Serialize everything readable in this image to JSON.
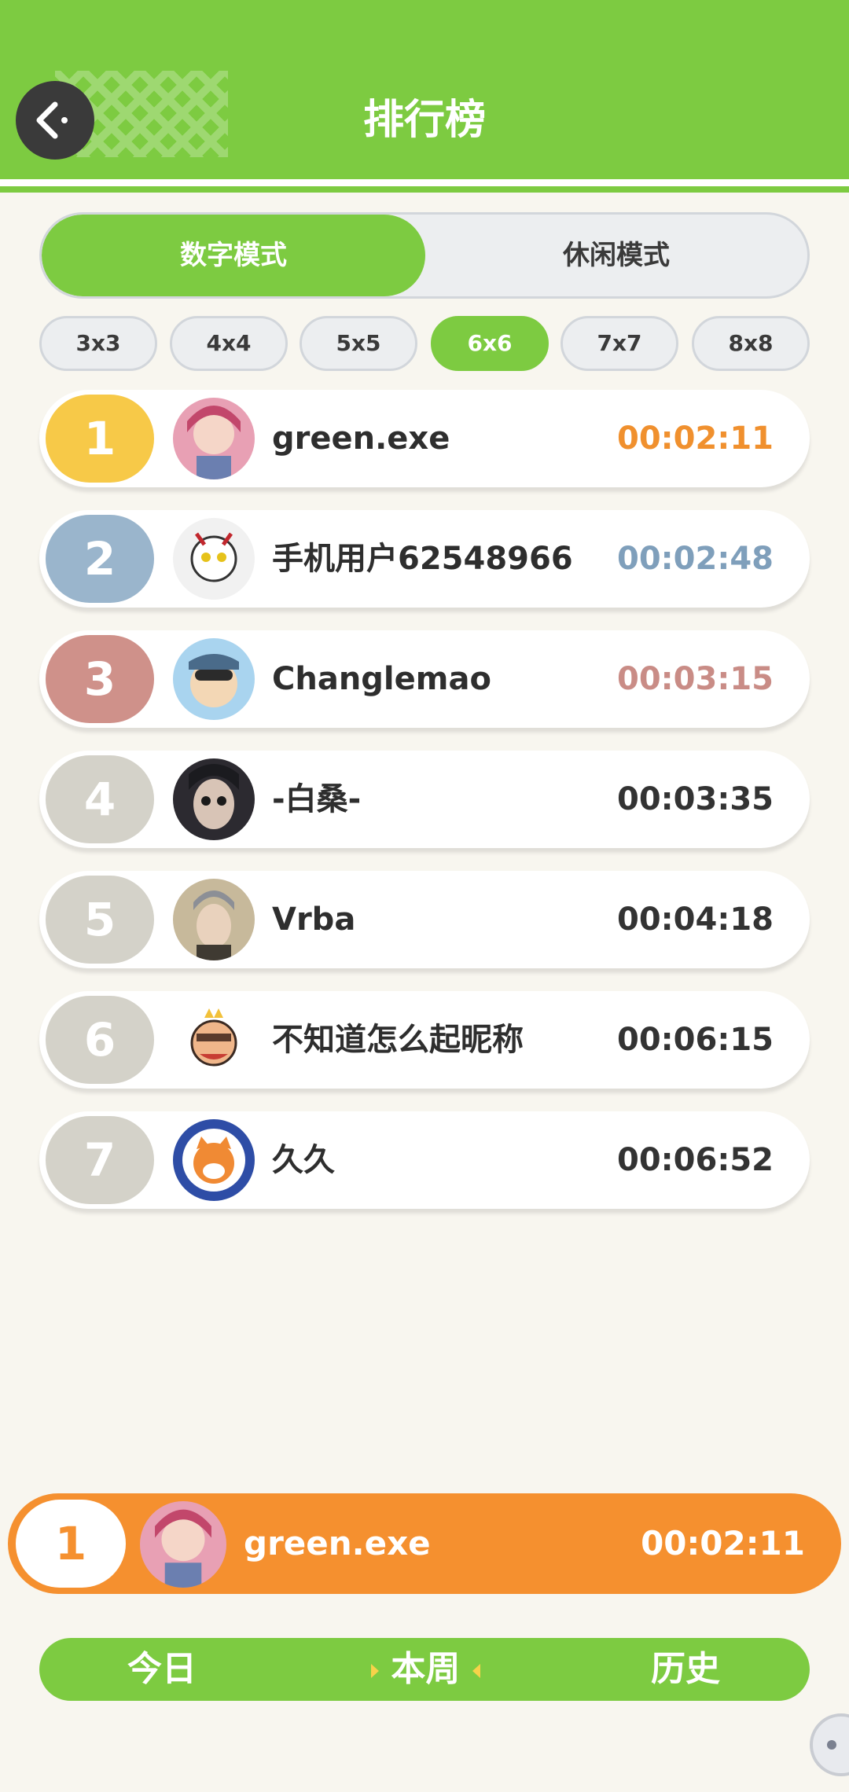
{
  "header": {
    "title": "排行榜",
    "back_icon": "back-arrow-icon"
  },
  "modes": [
    {
      "label": "数字模式",
      "active": true
    },
    {
      "label": "休闲模式",
      "active": false
    }
  ],
  "sizes": [
    {
      "label": "3x3",
      "active": false
    },
    {
      "label": "4x4",
      "active": false
    },
    {
      "label": "5x5",
      "active": false
    },
    {
      "label": "6x6",
      "active": true
    },
    {
      "label": "7x7",
      "active": false
    },
    {
      "label": "8x8",
      "active": false
    }
  ],
  "ranking": [
    {
      "rank": "1",
      "name": "green.exe",
      "time": "00:02:11",
      "badge_color": "#f7c948",
      "time_color": "#f0902e"
    },
    {
      "rank": "2",
      "name": "手机用户62548966",
      "time": "00:02:48",
      "badge_color": "#9ab5cc",
      "time_color": "#7f9fbb"
    },
    {
      "rank": "3",
      "name": "Changlemao",
      "time": "00:03:15",
      "badge_color": "#cf918a",
      "time_color": "#c98c86"
    },
    {
      "rank": "4",
      "name": "-白桑-",
      "time": "00:03:35",
      "badge_color": "#d4d2c9",
      "time_color": "#333333"
    },
    {
      "rank": "5",
      "name": "Vrba",
      "time": "00:04:18",
      "badge_color": "#d4d2c9",
      "time_color": "#333333"
    },
    {
      "rank": "6",
      "name": "不知道怎么起昵称",
      "time": "00:06:15",
      "badge_color": "#d4d2c9",
      "time_color": "#333333"
    },
    {
      "rank": "7",
      "name": "久久",
      "time": "00:06:52",
      "badge_color": "#d4d2c9",
      "time_color": "#333333"
    }
  ],
  "my_rank": {
    "rank": "1",
    "name": "green.exe",
    "time": "00:02:11"
  },
  "periods": [
    {
      "label": "今日",
      "active": false
    },
    {
      "label": "本周",
      "active": true
    },
    {
      "label": "历史",
      "active": false
    }
  ],
  "colors": {
    "primary_green": "#7dcb41",
    "accent_orange": "#f5902f",
    "background": "#f8f6ef"
  }
}
